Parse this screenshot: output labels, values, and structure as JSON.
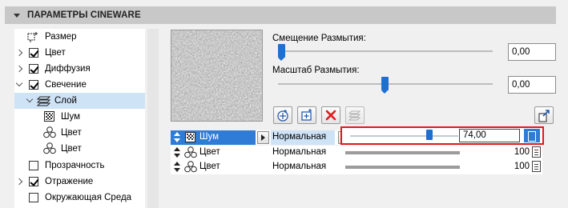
{
  "header": {
    "title": "ПАРАМЕТРЫ CINEWARE"
  },
  "tree": [
    {
      "label": "Размер",
      "checkbox": false,
      "expander": "none",
      "icon": "size-icon"
    },
    {
      "label": "Цвет",
      "checkbox": true,
      "checked": true,
      "expander": "collapsed"
    },
    {
      "label": "Диффузия",
      "checkbox": true,
      "checked": true,
      "expander": "collapsed"
    },
    {
      "label": "Свечение",
      "checkbox": true,
      "checked": true,
      "expander": "expanded"
    },
    {
      "label": "Слой",
      "checkbox": false,
      "expander": "expanded",
      "icon": "layers-icon",
      "selected": true
    },
    {
      "label": "Шум",
      "icon": "noise-icon"
    },
    {
      "label": "Цвет",
      "icon": "color-shader-icon"
    },
    {
      "label": "Цвет",
      "icon": "color-shader-icon"
    },
    {
      "label": "Прозрачность",
      "checkbox": true,
      "checked": false,
      "expander": "none"
    },
    {
      "label": "Отражение",
      "checkbox": true,
      "checked": true,
      "expander": "collapsed"
    },
    {
      "label": "Окружающая Среда",
      "checkbox": true,
      "checked": false,
      "expander": "none"
    }
  ],
  "params": {
    "blur_offset": {
      "label": "Смещение Размытия:",
      "value": "0,00",
      "level": 0.0
    },
    "blur_scale": {
      "label": "Масштаб Размытия:",
      "value": "0,00",
      "level": 0.5
    }
  },
  "toolbar": {
    "buttons": [
      "add-shader-icon",
      "add-folder-icon",
      "delete-icon",
      "layer-stack-icon"
    ],
    "right_button": "export-icon",
    "delete_color": "#e0191e"
  },
  "layers": [
    {
      "name": "Шум",
      "mode": "Нормальная",
      "value": "74,00",
      "level": 0.74,
      "selected": true,
      "icon": "noise-icon"
    },
    {
      "name": "Цвет",
      "mode": "Нормальная",
      "value": "100",
      "level": 1.0,
      "selected": false,
      "icon": "color-shader-icon"
    },
    {
      "name": "Цвет",
      "mode": "Нормальная",
      "value": "100",
      "level": 1.0,
      "selected": false,
      "icon": "color-shader-icon"
    }
  ],
  "colors": {
    "accent": "#2f7cd6",
    "highlight": "#e0191e",
    "selection": "#cfe3f7"
  }
}
